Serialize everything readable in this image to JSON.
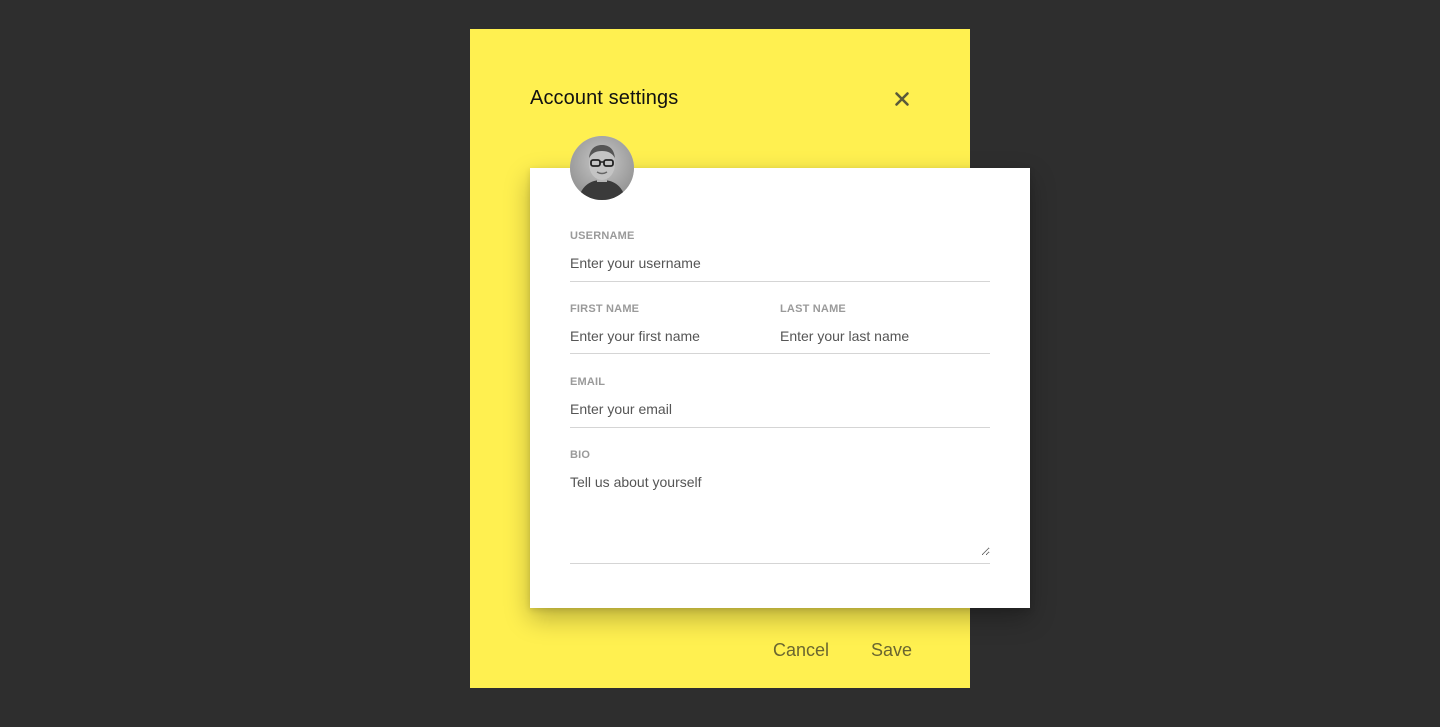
{
  "modal": {
    "title": "Account settings",
    "background_color": "#fff050",
    "close_icon": "close-icon"
  },
  "profile": {
    "avatar_icon": "avatar"
  },
  "form": {
    "username": {
      "label": "USERNAME",
      "placeholder": "Enter your username",
      "value": ""
    },
    "first_name": {
      "label": "FIRST NAME",
      "placeholder": "Enter your first name",
      "value": ""
    },
    "last_name": {
      "label": "LAST NAME",
      "placeholder": "Enter your last name",
      "value": ""
    },
    "email": {
      "label": "EMAIL",
      "placeholder": "Enter your email",
      "value": ""
    },
    "bio": {
      "label": "BIO",
      "placeholder": "Tell us about yourself",
      "value": ""
    }
  },
  "actions": {
    "cancel_label": "Cancel",
    "save_label": "Save"
  }
}
